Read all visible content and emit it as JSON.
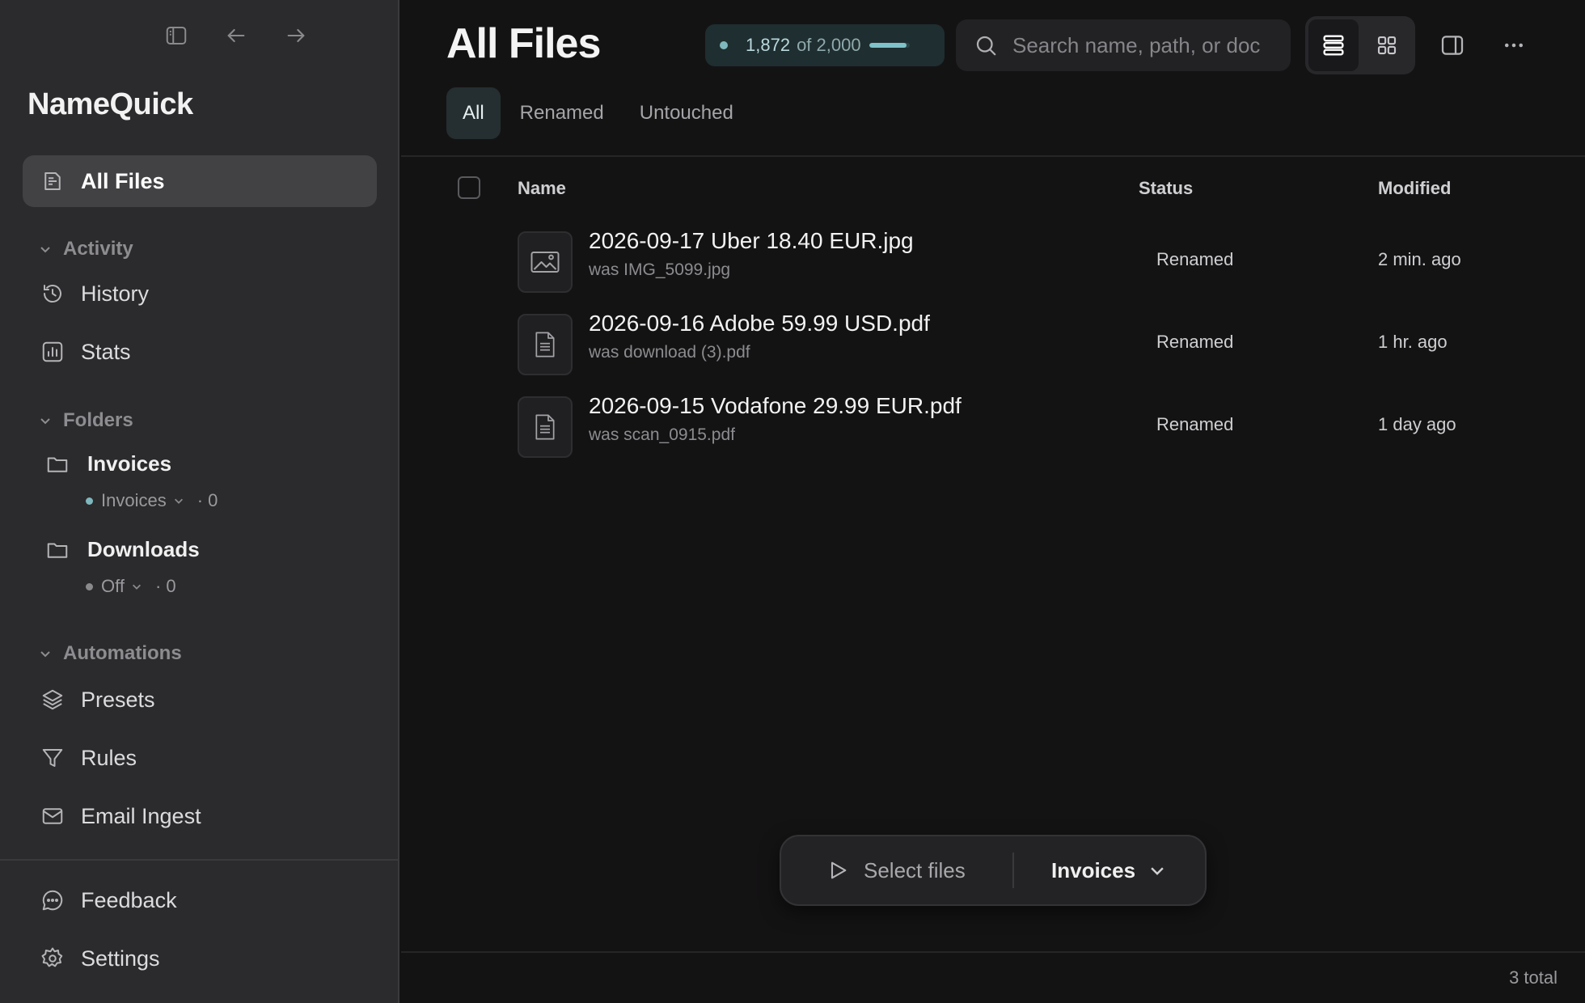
{
  "app": {
    "name": "NameQuick"
  },
  "sidebar": {
    "all_files": "All Files",
    "sections": {
      "activity": "Activity",
      "folders": "Folders",
      "automations": "Automations"
    },
    "activity_items": [
      {
        "label": "History",
        "icon": "history-icon"
      },
      {
        "label": "Stats",
        "icon": "stats-icon"
      }
    ],
    "folders": [
      {
        "name": "Invoices",
        "preset": "Invoices",
        "count": "· 0",
        "dot_color": "#7fb7be"
      },
      {
        "name": "Downloads",
        "preset": "Off",
        "count": "· 0",
        "dot_color": "#8a898c"
      }
    ],
    "automation_items": [
      {
        "label": "Presets",
        "icon": "layers-icon"
      },
      {
        "label": "Rules",
        "icon": "funnel-icon"
      },
      {
        "label": "Email Ingest",
        "icon": "mail-icon"
      }
    ],
    "footer_items": [
      {
        "label": "Feedback",
        "icon": "chat-icon"
      },
      {
        "label": "Settings",
        "icon": "gear-icon"
      }
    ]
  },
  "header": {
    "title": "All Files",
    "quota": {
      "used": "1,872",
      "of": "of 2,000",
      "fraction": 0.936
    },
    "search": {
      "placeholder": "Search name, path, or doc",
      "value": ""
    },
    "tabs": [
      "All",
      "Renamed",
      "Untouched"
    ],
    "active_tab": "All"
  },
  "table": {
    "columns": {
      "name": "Name",
      "status": "Status",
      "modified": "Modified"
    },
    "rows": [
      {
        "name": "2026-09-17 Uber 18.40 EUR.jpg",
        "was": "was IMG_5099.jpg",
        "status": "Renamed",
        "modified": "2 min. ago",
        "icon": "image-file-icon"
      },
      {
        "name": "2026-09-16 Adobe 59.99 USD.pdf",
        "was": "was download (3).pdf",
        "status": "Renamed",
        "modified": "1 hr. ago",
        "icon": "document-file-icon"
      },
      {
        "name": "2026-09-15 Vodafone 29.99 EUR.pdf",
        "was": "was scan_0915.pdf",
        "status": "Renamed",
        "modified": "1 day ago",
        "icon": "document-file-icon"
      }
    ]
  },
  "action_bar": {
    "select_label": "Select files",
    "preset": "Invoices"
  },
  "footer": {
    "total": "3 total"
  },
  "colors": {
    "accent": "#7fb7be",
    "background": "#141314",
    "sidebar": "#2b2a2c"
  }
}
